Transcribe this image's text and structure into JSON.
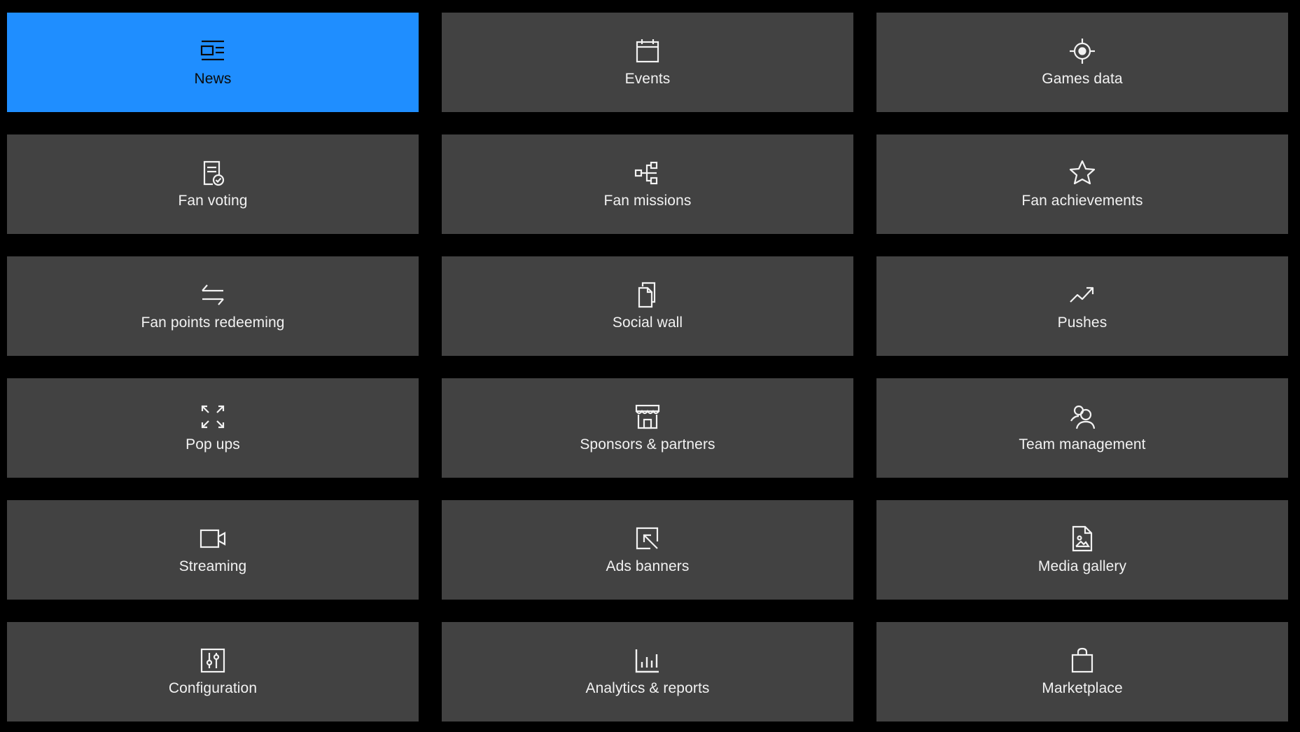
{
  "tiles": [
    {
      "label": "News",
      "icon": "news-icon",
      "active": true
    },
    {
      "label": "Events",
      "icon": "calendar-icon"
    },
    {
      "label": "Games data",
      "icon": "crosshair-icon"
    },
    {
      "label": "Fan voting",
      "icon": "ballot-check-icon"
    },
    {
      "label": "Fan missions",
      "icon": "hierarchy-icon"
    },
    {
      "label": "Fan achievements",
      "icon": "star-icon"
    },
    {
      "label": "Fan points redeeming",
      "icon": "swap-arrows-icon"
    },
    {
      "label": "Social wall",
      "icon": "documents-icon"
    },
    {
      "label": "Pushes",
      "icon": "trend-up-icon"
    },
    {
      "label": "Pop ups",
      "icon": "expand-icon"
    },
    {
      "label": "Sponsors & partners",
      "icon": "storefront-icon"
    },
    {
      "label": "Team management",
      "icon": "users-icon"
    },
    {
      "label": "Streaming",
      "icon": "video-camera-icon"
    },
    {
      "label": "Ads banners",
      "icon": "cursor-box-icon"
    },
    {
      "label": "Media gallery",
      "icon": "image-file-icon"
    },
    {
      "label": "Configuration",
      "icon": "sliders-icon"
    },
    {
      "label": "Analytics & reports",
      "icon": "bar-chart-icon"
    },
    {
      "label": "Marketplace",
      "icon": "shopping-bag-icon"
    }
  ],
  "colors": {
    "background": "#000000",
    "tile": "#424242",
    "active": "#1f8eff",
    "text": "#f2f2f2"
  }
}
